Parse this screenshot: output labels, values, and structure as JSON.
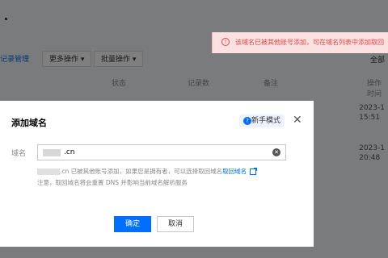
{
  "toolbar": {
    "link_label": "记录管理",
    "more_actions": "更多操作 ▾",
    "batch_actions": "批量操作 ▾",
    "right_text": "全部"
  },
  "table": {
    "headers": [
      "状态",
      "记录数",
      "备注",
      "操作时间"
    ],
    "rows": [
      {
        "time_date": "2023-1",
        "time_clock": "15:51"
      },
      {
        "time_date": "2023-1",
        "time_clock": "20:48"
      }
    ]
  },
  "toast": {
    "icon": "!",
    "message": "该域名已被其他账号添加，可在域名列表中添加取回"
  },
  "dialog": {
    "title": "添加域名",
    "mode_button": "新手模式",
    "close_icon": "✕",
    "field_label": "域名",
    "input_value": ".cn",
    "hint_line1_text": ".cn 已被其他账号添加，如果您是拥有者，可以选择取回域名",
    "hint_line1_link": "取回域名",
    "hint_line2": "注意，取回域名将会重置 DNS 并影响当前域名解析服务",
    "ok_button": "确定",
    "cancel_button": "取消"
  }
}
